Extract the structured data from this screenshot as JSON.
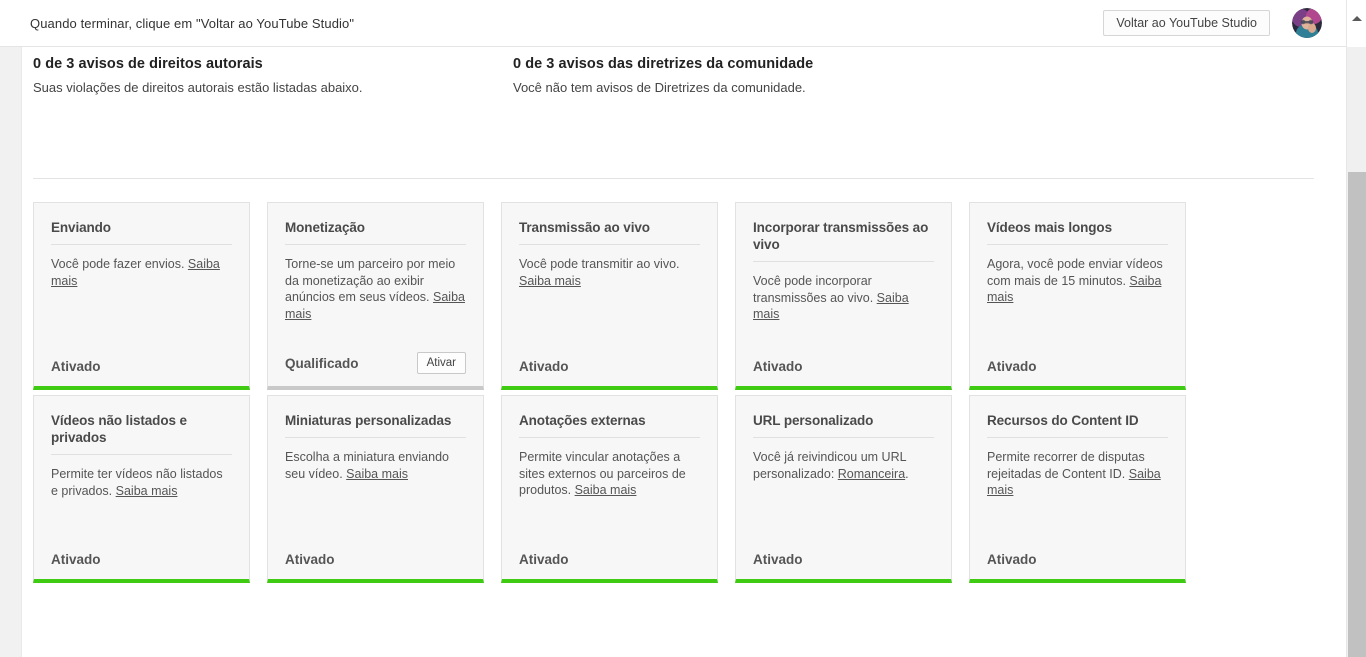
{
  "topbar": {
    "note": "Quando terminar, clique em \"Voltar ao YouTube Studio\"",
    "back_button_label": "Voltar ao YouTube Studio",
    "avatar_name": "user-avatar"
  },
  "notices": [
    {
      "title": "0 de 3 avisos de direitos autorais",
      "subtitle": "Suas violações de direitos autorais estão listadas abaixo."
    },
    {
      "title": "0 de 3 avisos das diretrizes da comunidade",
      "subtitle": "Você não tem avisos de Diretrizes da comunidade."
    }
  ],
  "cards": [
    {
      "name": "enviando",
      "title": "Enviando",
      "desc_before": "Você pode fazer envios. ",
      "link": "Saiba mais",
      "desc_after": "",
      "status": "Ativado",
      "action": null,
      "border_color": "#3ecb12"
    },
    {
      "name": "monetizacao",
      "title": "Monetização",
      "desc_before": "Torne-se um parceiro por meio da monetização ao exibir anúncios em seus vídeos. ",
      "link": "Saiba mais",
      "desc_after": "",
      "status": "Qualificado",
      "action": "Ativar",
      "border_color": "#c9c9c9"
    },
    {
      "name": "transmissao-ao-vivo",
      "title": "Transmissão ao vivo",
      "desc_before": "Você pode transmitir ao vivo. ",
      "link": "Saiba mais",
      "desc_after": "",
      "status": "Ativado",
      "action": null,
      "border_color": "#3ecb12"
    },
    {
      "name": "incorporar-transmissoes-ao-vivo",
      "title": "Incorporar transmissões ao vivo",
      "desc_before": "Você pode incorporar transmissões ao vivo. ",
      "link": "Saiba mais",
      "desc_after": "",
      "status": "Ativado",
      "action": null,
      "border_color": "#3ecb12"
    },
    {
      "name": "videos-mais-longos",
      "title": "Vídeos mais longos",
      "desc_before": "Agora, você pode enviar vídeos com mais de 15 minutos. ",
      "link": "Saiba mais",
      "desc_after": "",
      "status": "Ativado",
      "action": null,
      "border_color": "#3ecb12"
    },
    {
      "name": "videos-nao-listados-e-privados",
      "title": "Vídeos não listados e privados",
      "desc_before": "Permite ter vídeos não listados e privados. ",
      "link": "Saiba mais",
      "desc_after": "",
      "status": "Ativado",
      "action": null,
      "border_color": "#3ecb12"
    },
    {
      "name": "miniaturas-personalizadas",
      "title": "Miniaturas personalizadas",
      "desc_before": "Escolha a miniatura enviando seu vídeo. ",
      "link": "Saiba mais",
      "desc_after": "",
      "status": "Ativado",
      "action": null,
      "border_color": "#3ecb12"
    },
    {
      "name": "anotacoes-externas",
      "title": "Anotações externas",
      "desc_before": "Permite vincular anotações a sites externos ou parceiros de produtos. ",
      "link": "Saiba mais",
      "desc_after": "",
      "status": "Ativado",
      "action": null,
      "border_color": "#3ecb12"
    },
    {
      "name": "url-personalizado",
      "title": "URL personalizado",
      "desc_before": "Você já reivindicou um URL personalizado: ",
      "link": "Romanceira",
      "desc_after": ".",
      "status": "Ativado",
      "action": null,
      "border_color": "#3ecb12"
    },
    {
      "name": "recursos-do-content-id",
      "title": "Recursos do Content ID",
      "desc_before": "Permite recorrer de disputas rejeitadas de Content ID. ",
      "link": "Saiba mais",
      "desc_after": "",
      "status": "Ativado",
      "action": null,
      "border_color": "#3ecb12"
    }
  ],
  "scrollbar": {
    "up_arrow_icon": "triangle-up-icon",
    "thumb_name": "vertical-scrollbar-thumb"
  }
}
